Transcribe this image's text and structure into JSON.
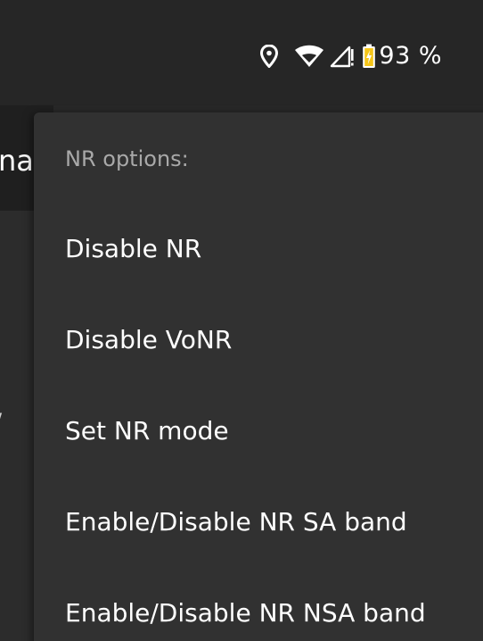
{
  "status_bar": {
    "battery_percent": "93 %",
    "icons": [
      "location-icon",
      "wifi-icon",
      "cell-signal-icon",
      "battery-charging-icon"
    ]
  },
  "background_app": {
    "title_fragment": "na",
    "side_mark": "/"
  },
  "popup": {
    "header": "NR options:",
    "items": [
      {
        "label": "Disable NR"
      },
      {
        "label": "Disable VoNR"
      },
      {
        "label": "Set NR mode"
      },
      {
        "label": "Enable/Disable NR SA band"
      },
      {
        "label": "Enable/Disable NR NSA band"
      }
    ]
  },
  "colors": {
    "background": "#282828",
    "popup_background": "#313131",
    "header_text": "#a9a9a9",
    "item_text": "#ffffff",
    "battery_fill": "#f5c518"
  }
}
